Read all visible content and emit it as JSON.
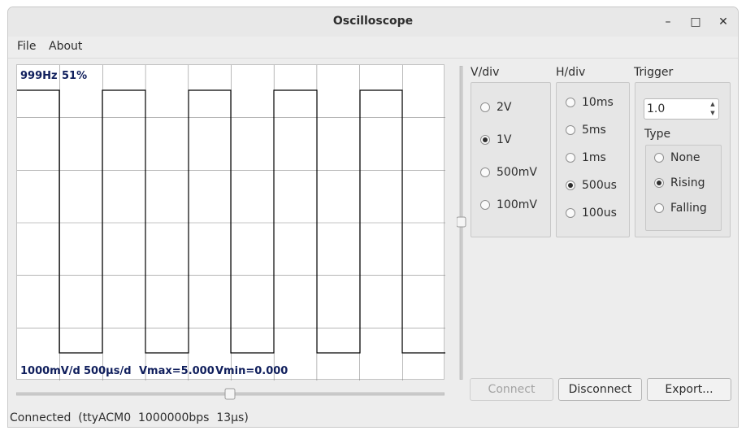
{
  "window": {
    "title": "Oscilloscope",
    "controls": {
      "minimize": "–",
      "maximize": "□",
      "close": "✕"
    }
  },
  "menu": {
    "file": "File",
    "about": "About"
  },
  "scope": {
    "freq": "999Hz",
    "duty": "51%",
    "vdiv_info": "1000mV/d",
    "hdiv_info": "500µs/d",
    "vmax": "Vmax=5.000",
    "vmin": "Vmin=0.000",
    "colors": {
      "grid": "#8a8a8a",
      "trace": "#000000",
      "overlay_text": "#0f1e5c"
    }
  },
  "vdiv": {
    "label": "V/div",
    "options": [
      "2V",
      "1V",
      "500mV",
      "100mV"
    ],
    "selected": "1V"
  },
  "hdiv": {
    "label": "H/div",
    "options": [
      "10ms",
      "5ms",
      "1ms",
      "500us",
      "100us"
    ],
    "selected": "500us"
  },
  "trigger": {
    "label": "Trigger",
    "level": "1.0",
    "type_label": "Type",
    "types": [
      "None",
      "Rising",
      "Falling"
    ],
    "selected": "Rising"
  },
  "buttons": {
    "connect": "Connect",
    "disconnect": "Disconnect",
    "export": "Export..."
  },
  "status": {
    "text": "Connected  (ttyACM0  1000000bps  13µs)"
  }
}
